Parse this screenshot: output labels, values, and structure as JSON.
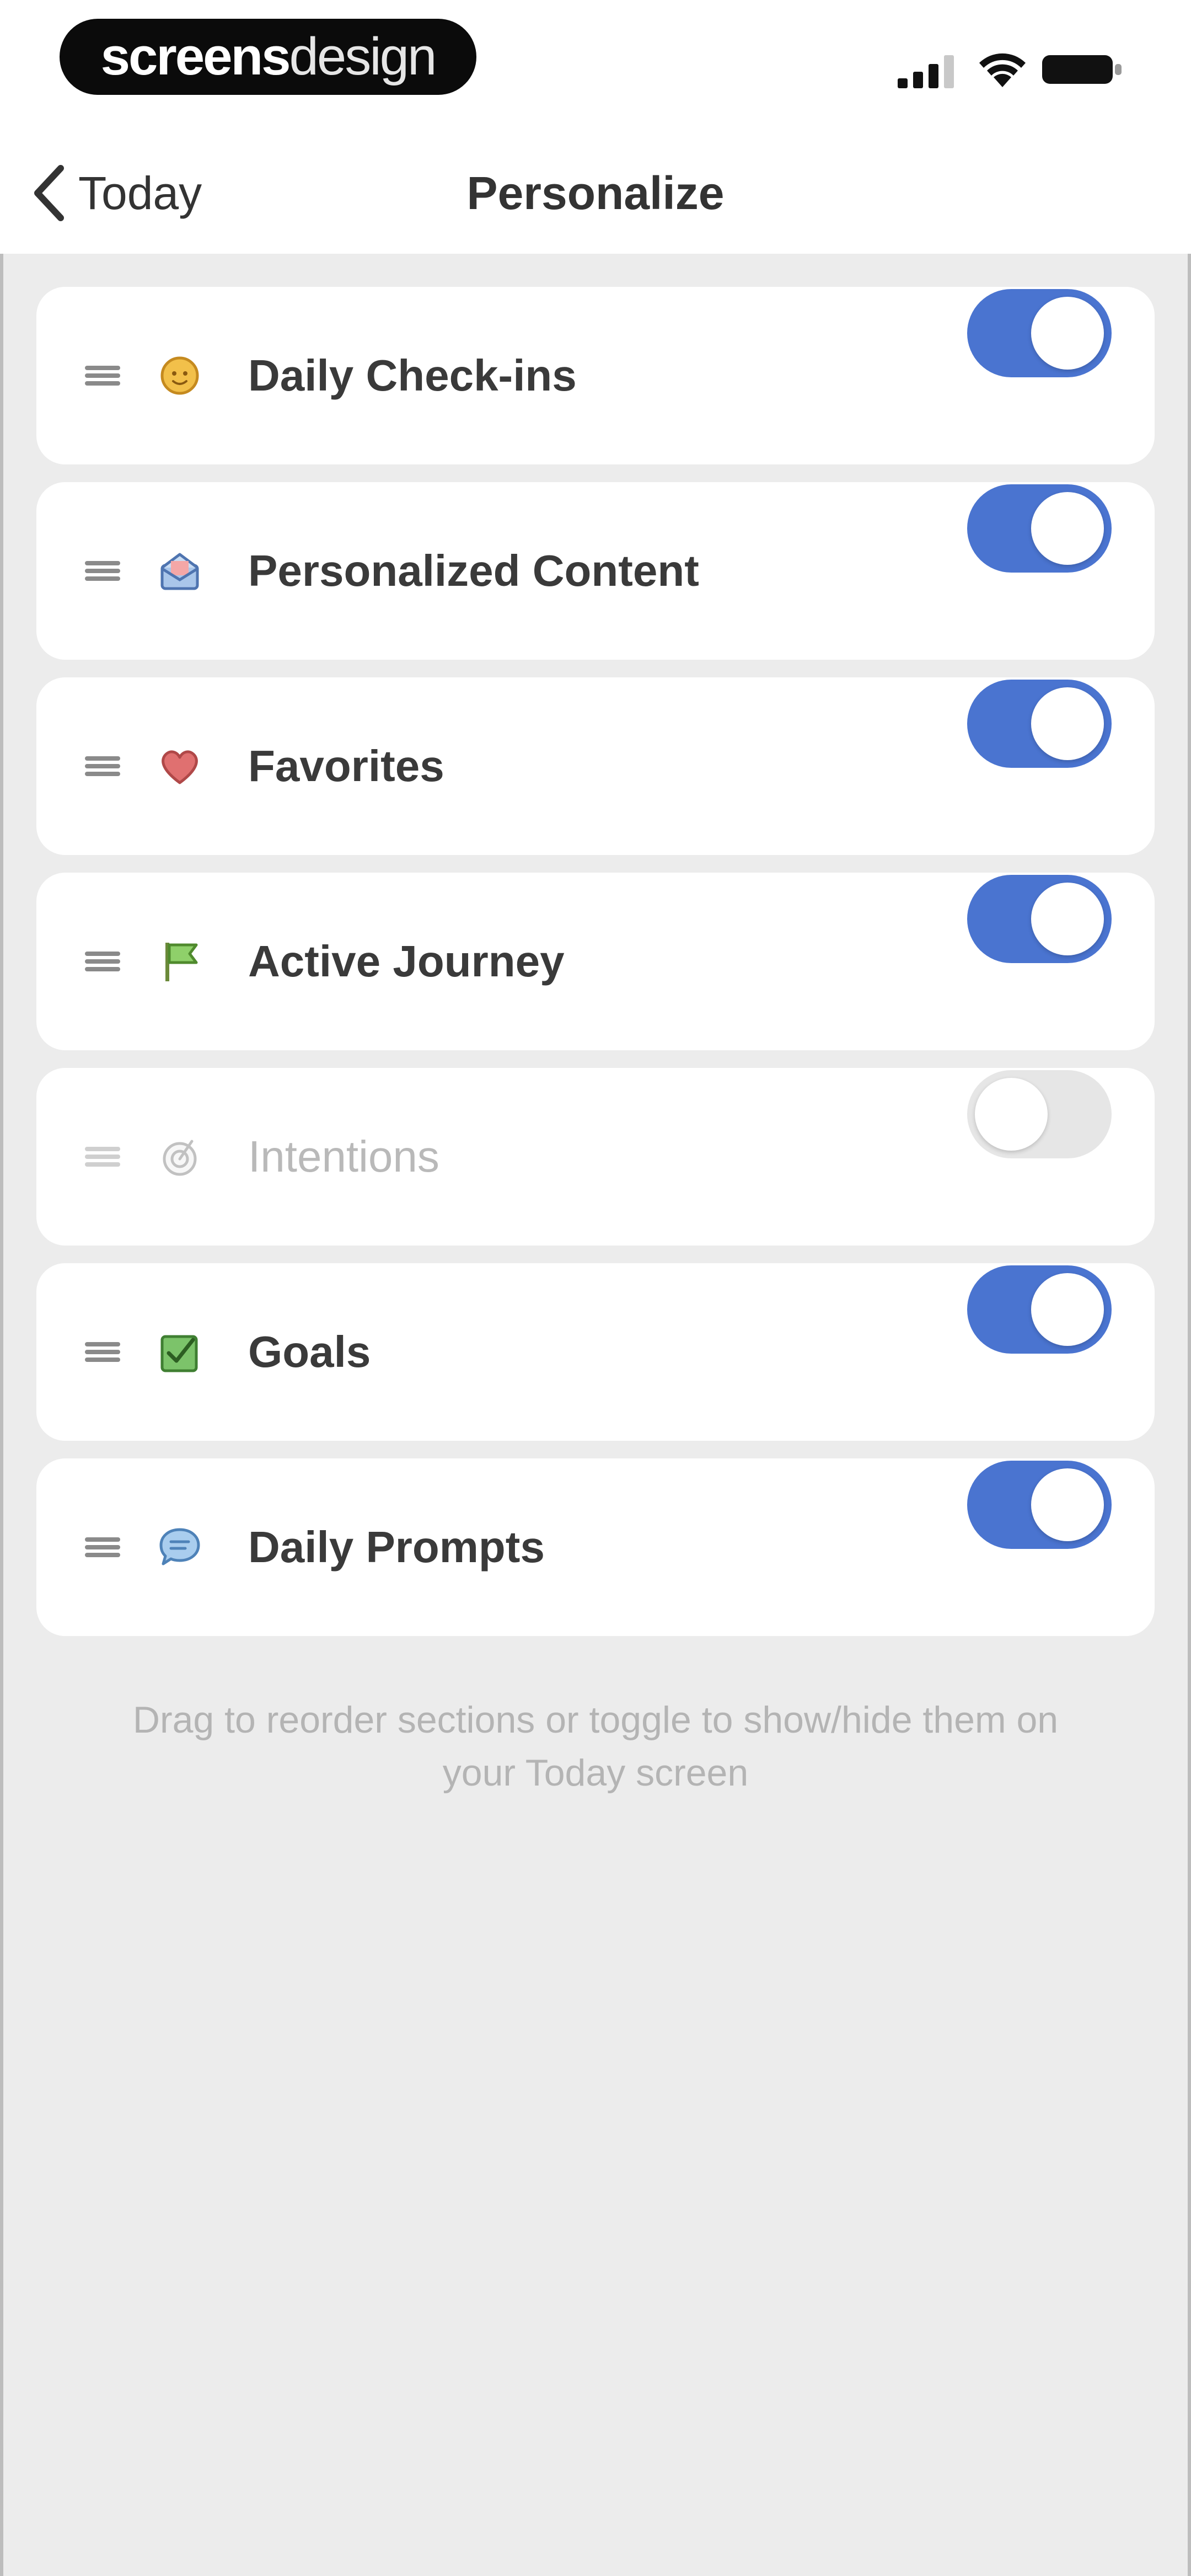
{
  "status_bar": {
    "brand_part1": "screens",
    "brand_part2": "design",
    "signal_icon": "cellular-signal-icon",
    "wifi_icon": "wifi-icon",
    "battery_icon": "battery-icon"
  },
  "nav": {
    "back_label": "Today",
    "title": "Personalize",
    "back_icon": "chevron-left-icon"
  },
  "colors": {
    "toggle_on": "#4a74d0",
    "toggle_off": "#e6e6e6",
    "background": "#ececec"
  },
  "sections": [
    {
      "label": "Daily Check-ins",
      "icon": "sun-face-icon",
      "enabled": true
    },
    {
      "label": "Personalized Content",
      "icon": "mail-envelope-icon",
      "enabled": true
    },
    {
      "label": "Favorites",
      "icon": "heart-icon",
      "enabled": true
    },
    {
      "label": "Active Journey",
      "icon": "flag-icon",
      "enabled": true
    },
    {
      "label": "Intentions",
      "icon": "target-icon",
      "enabled": false
    },
    {
      "label": "Goals",
      "icon": "checkbox-icon",
      "enabled": true
    },
    {
      "label": "Daily Prompts",
      "icon": "speech-bubble-icon",
      "enabled": true
    }
  ],
  "footer": {
    "line1": "Drag to reorder sections or toggle to show/hide them on",
    "line2": "your Today screen"
  }
}
